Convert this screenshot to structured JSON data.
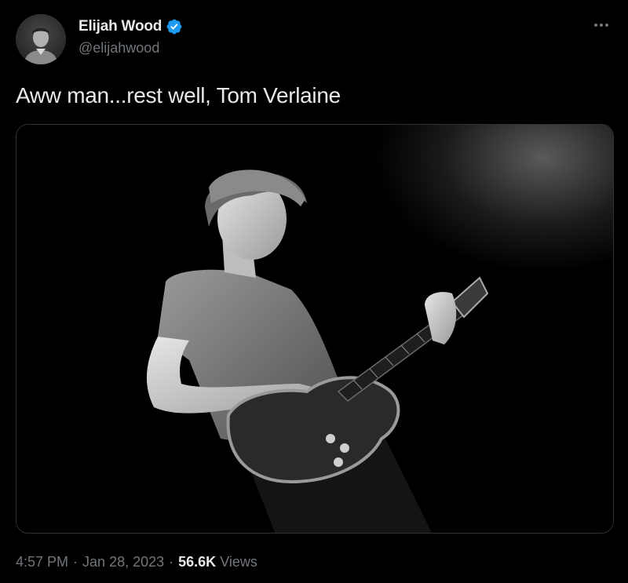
{
  "author": {
    "display_name": "Elijah Wood",
    "handle": "@elijahwood",
    "verified": true,
    "verified_color": "#1d9bf0"
  },
  "tweet": {
    "text": "Aww man...rest well, Tom Verlaine"
  },
  "meta": {
    "time": "4:57 PM",
    "date": "Jan 28, 2023",
    "separator": "·",
    "views_count": "56.6K",
    "views_label": "Views"
  },
  "icons": {
    "more": "more-horizontal-icon",
    "verified": "verified-badge-icon"
  },
  "colors": {
    "background": "#000000",
    "text_primary": "#e7e9ea",
    "text_secondary": "#71767b",
    "border": "#2f3336"
  }
}
